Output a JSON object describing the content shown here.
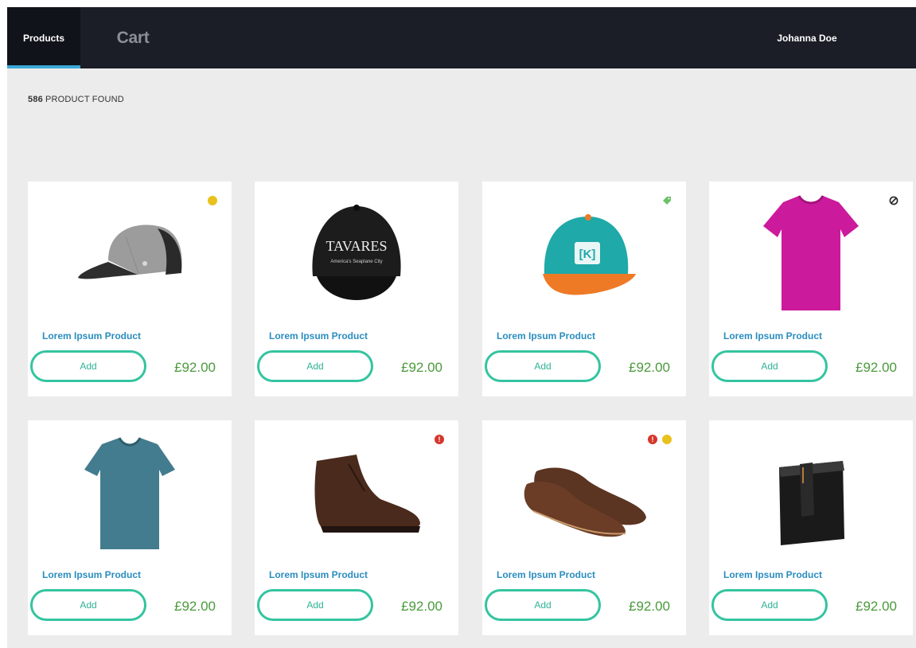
{
  "nav": {
    "tabs": [
      {
        "label": "Products",
        "active": true
      },
      {
        "label": "Cart",
        "active": false
      }
    ],
    "user_name": "Johanna Doe"
  },
  "results": {
    "count": "586",
    "label": "PRODUCT FOUND"
  },
  "products": [
    {
      "name": "Lorem Ipsum Product",
      "button": "Add",
      "price": "£92.00",
      "image": "grey-baseball-cap",
      "badges": [
        "yellow-dot"
      ]
    },
    {
      "name": "Lorem Ipsum Product",
      "button": "Add",
      "price": "£92.00",
      "image": "black-cap-tavares",
      "badges": []
    },
    {
      "name": "Lorem Ipsum Product",
      "button": "Add",
      "price": "£92.00",
      "image": "teal-orange-snapback",
      "badges": [
        "green-tag"
      ]
    },
    {
      "name": "Lorem Ipsum Product",
      "button": "Add",
      "price": "£92.00",
      "image": "pink-t-shirt",
      "badges": [
        "blocked-icon"
      ]
    },
    {
      "name": "Lorem Ipsum Product",
      "button": "Add",
      "price": "£92.00",
      "image": "teal-t-shirt",
      "badges": []
    },
    {
      "name": "Lorem Ipsum Product",
      "button": "Add",
      "price": "£92.00",
      "image": "brown-ankle-boot",
      "badges": [
        "red-alert"
      ]
    },
    {
      "name": "Lorem Ipsum Product",
      "button": "Add",
      "price": "£92.00",
      "image": "brown-oxford-shoes",
      "badges": [
        "red-alert",
        "yellow-dot"
      ]
    },
    {
      "name": "Lorem Ipsum Product",
      "button": "Add",
      "price": "£92.00",
      "image": "black-wallet",
      "badges": []
    }
  ],
  "cap_logo_text": "TAVARES",
  "cap_sub_text": "America's Seaplane City",
  "snapback_logo": "[K]",
  "badge_alert_symbol": "!",
  "colors": {
    "navbar": "#1b1e27",
    "active_tab": "#11131a",
    "tab_underline": "#3aa8d8",
    "product_name": "#2b8dbf",
    "add_button": "#34c4a0",
    "price": "#4a9b3c",
    "badge_yellow": "#e9c11c",
    "badge_red": "#d5362a",
    "badge_green": "#6cc16a",
    "background": "#ececec"
  }
}
